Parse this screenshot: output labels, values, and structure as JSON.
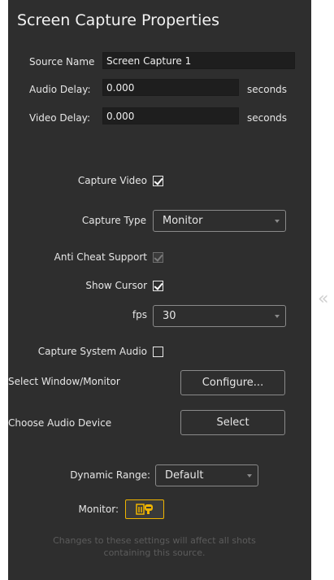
{
  "panel": {
    "title": "Screen Capture Properties",
    "source_name": {
      "label": "Source Name",
      "value": "Screen Capture 1"
    },
    "audio_delay": {
      "label": "Audio Delay:",
      "value": "0.000",
      "unit": "seconds"
    },
    "video_delay": {
      "label": "Video Delay:",
      "value": "0.000",
      "unit": "seconds"
    },
    "capture_video": {
      "label": "Capture Video",
      "checked": true
    },
    "capture_type": {
      "label": "Capture Type",
      "value": "Monitor"
    },
    "anti_cheat": {
      "label": "Anti Cheat Support",
      "checked": true,
      "disabled": true
    },
    "show_cursor": {
      "label": "Show Cursor",
      "checked": true
    },
    "fps": {
      "label": "fps",
      "value": "30"
    },
    "capture_system_audio": {
      "label": "Capture System Audio",
      "checked": false
    },
    "select_window": {
      "label": "Select Window/Monitor",
      "button": "Configure..."
    },
    "audio_device": {
      "label": "Choose Audio Device",
      "button": "Select"
    },
    "dynamic_range": {
      "label": "Dynamic Range:",
      "value": "Default"
    },
    "monitor": {
      "label": "Monitor:"
    },
    "footer": "Changes to these settings will affect all shots containing this source."
  },
  "collapse_glyph": "«",
  "colors": {
    "accent": "#f0b400",
    "panel_bg": "#2e2e2e",
    "field_bg": "#1e1e1e"
  },
  "icons": {
    "monitor": "headphones-speaker-icon",
    "collapse": "double-chevron-left-icon"
  }
}
